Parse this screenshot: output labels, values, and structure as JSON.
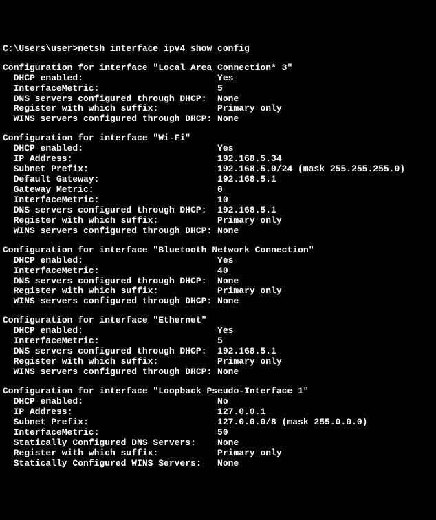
{
  "prompt": {
    "path": "C:\\Users\\user>",
    "command": "netsh interface ipv4 show config"
  },
  "sections": [
    {
      "header_prefix": "Configuration for interface \"",
      "name": "Local Area Connection* 3",
      "header_suffix": "\"",
      "fields": [
        {
          "label": "DHCP enabled:",
          "value": "Yes"
        },
        {
          "label": "InterfaceMetric:",
          "value": "5"
        },
        {
          "label": "DNS servers configured through DHCP:",
          "value": "None"
        },
        {
          "label": "Register with which suffix:",
          "value": "Primary only"
        },
        {
          "label": "WINS servers configured through DHCP:",
          "value": "None"
        }
      ]
    },
    {
      "header_prefix": "Configuration for interface \"",
      "name": "Wi-Fi",
      "header_suffix": "\"",
      "fields": [
        {
          "label": "DHCP enabled:",
          "value": "Yes"
        },
        {
          "label": "IP Address:",
          "value": "192.168.5.34"
        },
        {
          "label": "Subnet Prefix:",
          "value": "192.168.5.0/24 (mask 255.255.255.0)"
        },
        {
          "label": "Default Gateway:",
          "value": "192.168.5.1"
        },
        {
          "label": "Gateway Metric:",
          "value": "0"
        },
        {
          "label": "InterfaceMetric:",
          "value": "10"
        },
        {
          "label": "DNS servers configured through DHCP:",
          "value": "192.168.5.1"
        },
        {
          "label": "Register with which suffix:",
          "value": "Primary only"
        },
        {
          "label": "WINS servers configured through DHCP:",
          "value": "None"
        }
      ]
    },
    {
      "header_prefix": "Configuration for interface \"",
      "name": "Bluetooth Network Connection",
      "header_suffix": "\"",
      "fields": [
        {
          "label": "DHCP enabled:",
          "value": "Yes"
        },
        {
          "label": "InterfaceMetric:",
          "value": "40"
        },
        {
          "label": "DNS servers configured through DHCP:",
          "value": "None"
        },
        {
          "label": "Register with which suffix:",
          "value": "Primary only"
        },
        {
          "label": "WINS servers configured through DHCP:",
          "value": "None"
        }
      ]
    },
    {
      "header_prefix": "Configuration for interface \"",
      "name": "Ethernet",
      "header_suffix": "\"",
      "fields": [
        {
          "label": "DHCP enabled:",
          "value": "Yes"
        },
        {
          "label": "InterfaceMetric:",
          "value": "5"
        },
        {
          "label": "DNS servers configured through DHCP:",
          "value": "192.168.5.1"
        },
        {
          "label": "Register with which suffix:",
          "value": "Primary only"
        },
        {
          "label": "WINS servers configured through DHCP:",
          "value": "None"
        }
      ]
    },
    {
      "header_prefix": "Configuration for interface \"",
      "name": "Loopback Pseudo-Interface 1",
      "header_suffix": "\"",
      "fields": [
        {
          "label": "DHCP enabled:",
          "value": "No"
        },
        {
          "label": "IP Address:",
          "value": "127.0.0.1"
        },
        {
          "label": "Subnet Prefix:",
          "value": "127.0.0.0/8 (mask 255.0.0.0)"
        },
        {
          "label": "InterfaceMetric:",
          "value": "50"
        },
        {
          "label": "Statically Configured DNS Servers:",
          "value": "None"
        },
        {
          "label": "Register with which suffix:",
          "value": "Primary only"
        },
        {
          "label": "Statically Configured WINS Servers:",
          "value": "None"
        }
      ]
    }
  ]
}
